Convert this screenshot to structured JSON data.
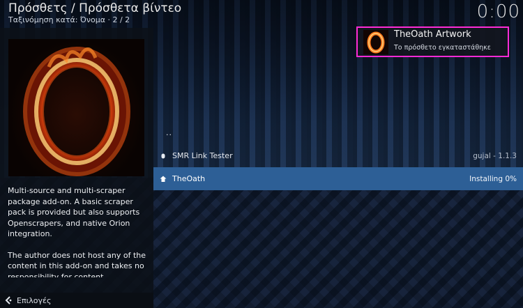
{
  "header": {
    "title": "Πρόσθετς / Πρόσθετα βίντεο",
    "sort_line": "Ταξινόμηση κατά: Όνομα  ·  2 / 2",
    "clock": "0:00"
  },
  "info_panel": {
    "poster_icon": "flaming-o-logo",
    "description_paragraphs": [
      "Multi-source and multi-scraper package add-on. A basic scraper pack is provided but also supports Openscrapers, and native Orion integration.",
      "The author does not host any of the content in this add-on and takes no responsibility for content"
    ]
  },
  "list": {
    "items": [
      {
        "label": "..",
        "meta": "",
        "icon": ""
      },
      {
        "label": "SMR Link Tester",
        "meta": "gujal - 1.1.3",
        "icon": "bullet-icon"
      },
      {
        "label": "TheOath",
        "meta": "Installing 0%",
        "icon": "install-icon",
        "selected": true
      }
    ]
  },
  "notification": {
    "title": "TheOath Artwork",
    "message": "Το πρόσθετο εγκαταστάθηκε",
    "border_color": "#ff2bd6"
  },
  "footer": {
    "label": "Επιλογές",
    "icon": "options-icon"
  },
  "colors": {
    "selection": "#2d5f96"
  }
}
